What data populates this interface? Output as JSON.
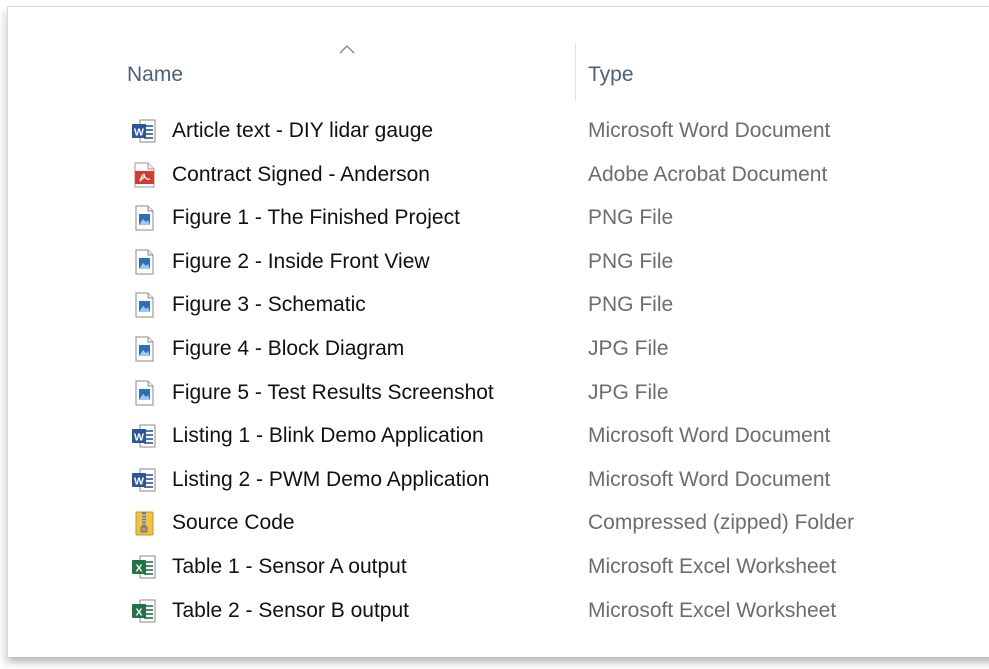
{
  "columns": {
    "name": "Name",
    "type": "Type"
  },
  "sort": {
    "icon": "chevron-up-icon"
  },
  "files": [
    {
      "name": "Article text - DIY lidar gauge",
      "type": "Microsoft Word Document",
      "icon": "word"
    },
    {
      "name": "Contract Signed - Anderson",
      "type": "Adobe Acrobat Document",
      "icon": "pdf"
    },
    {
      "name": "Figure 1 - The Finished Project",
      "type": "PNG File",
      "icon": "image"
    },
    {
      "name": "Figure 2 - Inside Front View",
      "type": "PNG File",
      "icon": "image"
    },
    {
      "name": "Figure 3 - Schematic",
      "type": "PNG File",
      "icon": "image"
    },
    {
      "name": "Figure 4 - Block Diagram",
      "type": "JPG File",
      "icon": "image"
    },
    {
      "name": "Figure 5 - Test Results Screenshot",
      "type": "JPG File",
      "icon": "image"
    },
    {
      "name": "Listing 1 - Blink Demo Application",
      "type": "Microsoft Word Document",
      "icon": "word"
    },
    {
      "name": "Listing 2 - PWM Demo Application",
      "type": "Microsoft Word Document",
      "icon": "word"
    },
    {
      "name": "Source Code",
      "type": "Compressed (zipped) Folder",
      "icon": "zip"
    },
    {
      "name": "Table 1 - Sensor A output",
      "type": "Microsoft Excel Worksheet",
      "icon": "excel"
    },
    {
      "name": "Table 2 - Sensor B output",
      "type": "Microsoft Excel Worksheet",
      "icon": "excel"
    }
  ],
  "colors": {
    "header_text": "#4c607a",
    "name_text": "#111111",
    "type_text": "#6d6d6d",
    "word_blue": "#2b579a",
    "excel_green": "#217346",
    "pdf_red": "#d73a2f",
    "zip_yellow": "#f2c23c"
  }
}
